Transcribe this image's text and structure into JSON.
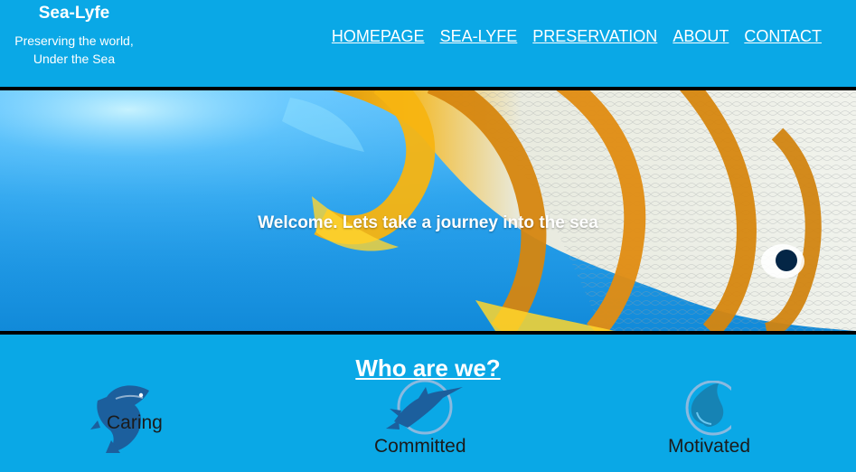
{
  "header": {
    "brand_title": "Sea-Lyfe",
    "brand_tagline": "Preserving the world,\nUnder the Sea"
  },
  "nav": {
    "items": [
      {
        "label": "HOMEPAGE"
      },
      {
        "label": "SEA-LYFE"
      },
      {
        "label": "PRESERVATION"
      },
      {
        "label": "ABOUT"
      },
      {
        "label": "CONTACT"
      }
    ]
  },
  "hero": {
    "message": "Welcome. Lets take a journey into the sea"
  },
  "section": {
    "title": "Who are we?"
  },
  "features": [
    {
      "label": "Caring",
      "icon": "fish-icon"
    },
    {
      "label": "Committed",
      "icon": "swordfish-icon"
    },
    {
      "label": "Motivated",
      "icon": "water-drop-icon"
    }
  ],
  "colors": {
    "page_background": "#0aa8e6",
    "hero_dark_border": "#000000",
    "icon_blue": "#1c5f9d",
    "icon_teal": "#1683b4"
  }
}
